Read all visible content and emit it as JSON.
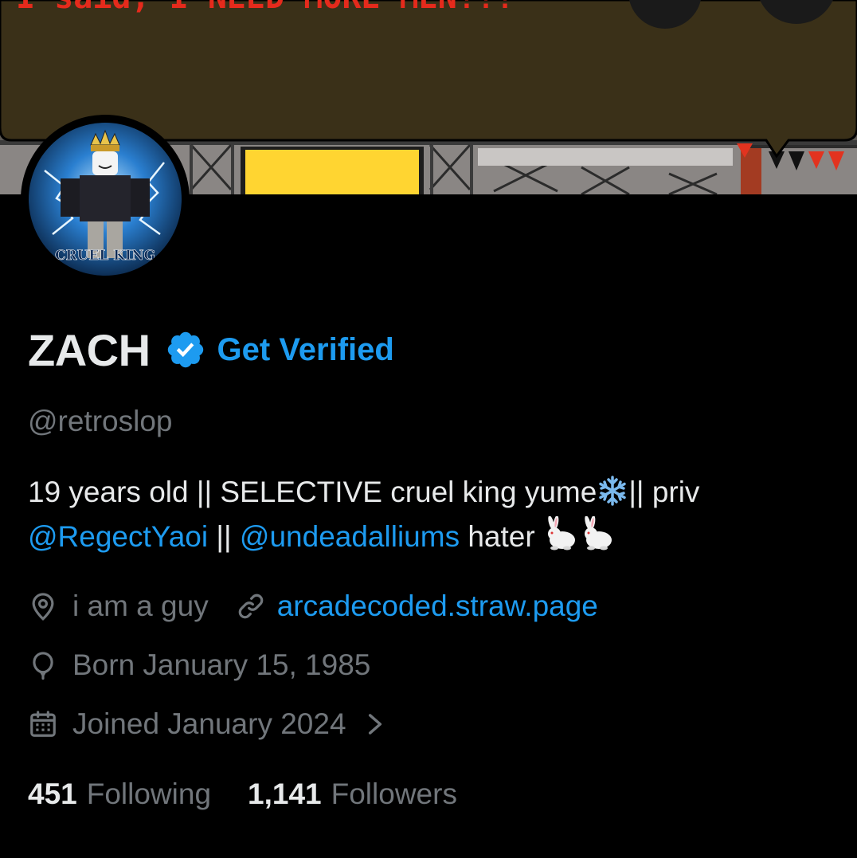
{
  "banner": {
    "caption": "I said, I NEED MORE MEN!!!"
  },
  "avatar": {
    "caption": "CRUEL KING"
  },
  "profile": {
    "display_name": "ZACH",
    "verified_icon": "verified-badge-icon",
    "get_verified_label": "Get Verified",
    "handle": "@retroslop"
  },
  "bio": {
    "line1_text": "19 years old || SELECTIVE cruel king yume",
    "line1_emoji": "snowflake",
    "line1_tail": "|| priv",
    "mention1": "@RegectYaoi",
    "separator": " || ",
    "mention2": "@undeadalliums",
    "tail": " hater",
    "emojis": [
      "rabbit",
      "rabbit"
    ]
  },
  "meta": {
    "location": "i am a guy",
    "location_icon": "location-pin-icon",
    "website": "arcadecoded.straw.page",
    "website_icon": "link-icon",
    "birthday": "Born January 15, 1985",
    "birthday_icon": "balloon-icon",
    "joined": "Joined January 2024",
    "joined_icon": "calendar-icon"
  },
  "stats": {
    "following_count": "451",
    "following_label": "Following",
    "followers_count": "1,141",
    "followers_label": "Followers"
  },
  "colors": {
    "background": "#000000",
    "text_primary": "#e7e9ea",
    "text_secondary": "#71767b",
    "accent": "#1d9bf0"
  }
}
